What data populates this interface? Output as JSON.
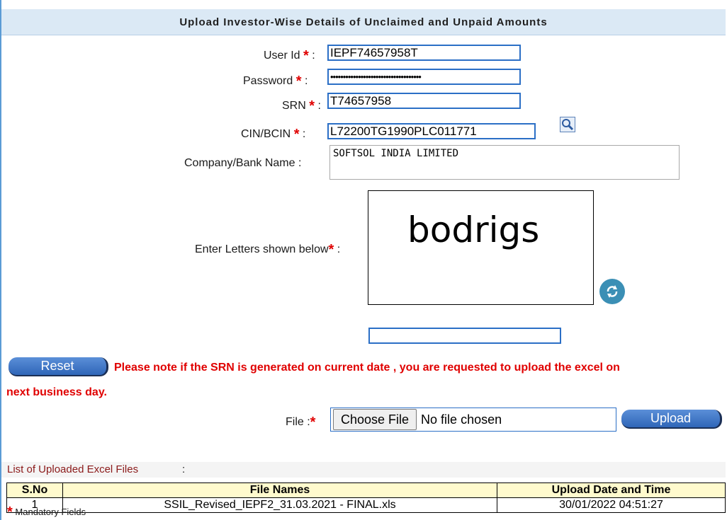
{
  "form": {
    "title": "Upload Investor-Wise Details of Unclaimed and Unpaid Amounts",
    "required_marker": "*",
    "user_id": {
      "label": "User Id",
      "value": "IEPF74657958T"
    },
    "password": {
      "label": "Password",
      "value": "••••••••••••••••••••••••••••••••••••"
    },
    "srn": {
      "label": "SRN",
      "value": "T74657958"
    },
    "cin": {
      "label": "CIN/BCIN",
      "value": "L72200TG1990PLC011771"
    },
    "company": {
      "label": "Company/Bank Name",
      "value": "SOFTSOL INDIA LIMITED"
    },
    "captcha": {
      "label": "Enter Letters shown below",
      "image_text": "bodrigs",
      "value": ""
    },
    "reset_label": "Reset",
    "notice_line1": "Please note if the SRN is generated on current date , you are requested to upload the excel on",
    "notice_line2": "next business day.",
    "file": {
      "label": "File :",
      "choose_label": "Choose File",
      "status": "No file chosen"
    },
    "upload_label": "Upload"
  },
  "uploads": {
    "title": "List of Uploaded Excel Files",
    "colon": ":",
    "headers": [
      "S.No",
      "File Names",
      "Upload Date and Time"
    ],
    "rows": [
      [
        "1",
        "SSIL_Revised_IEPF2_31.03.2021 - FINAL.xls",
        "30/01/2022 04:51:27"
      ]
    ]
  },
  "footer": {
    "mandatory_text": "Mandatory Fields"
  },
  "colors": {
    "accent": "#2f66b8",
    "required": "#e00000",
    "header_bg": "#dbe9f5",
    "table_header_bg": "#fffacd"
  },
  "icons": [
    "search-icon",
    "refresh-icon"
  ]
}
